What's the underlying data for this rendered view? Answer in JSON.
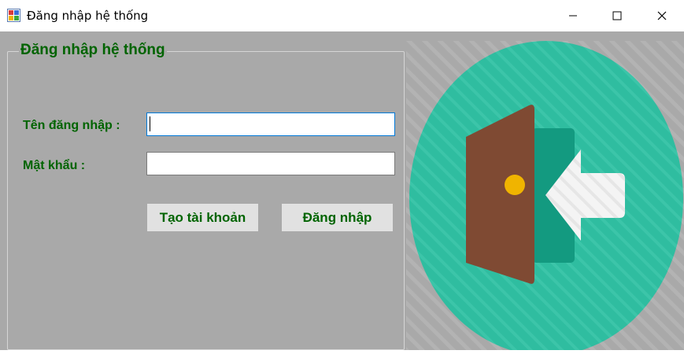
{
  "window": {
    "title": "Đăng nhập hệ thống",
    "controls": [
      "minimize-icon",
      "maximize-icon",
      "close-icon"
    ]
  },
  "login_group": {
    "legend": "Đăng nhập hệ thống",
    "username_label": "Tên đăng nhập :",
    "username_value": "",
    "password_label": "Mật khẩu :",
    "password_value": "",
    "create_account_button": "Tạo tài khoản",
    "login_button": "Đăng nhập"
  },
  "illustration": {
    "icon": "door-enter-icon"
  },
  "colors": {
    "form_background": "#a9a9a9",
    "label_text": "#006400",
    "circle": "#2fbda0",
    "door": "#7f4a33",
    "arrow": "#f2f2f2"
  }
}
